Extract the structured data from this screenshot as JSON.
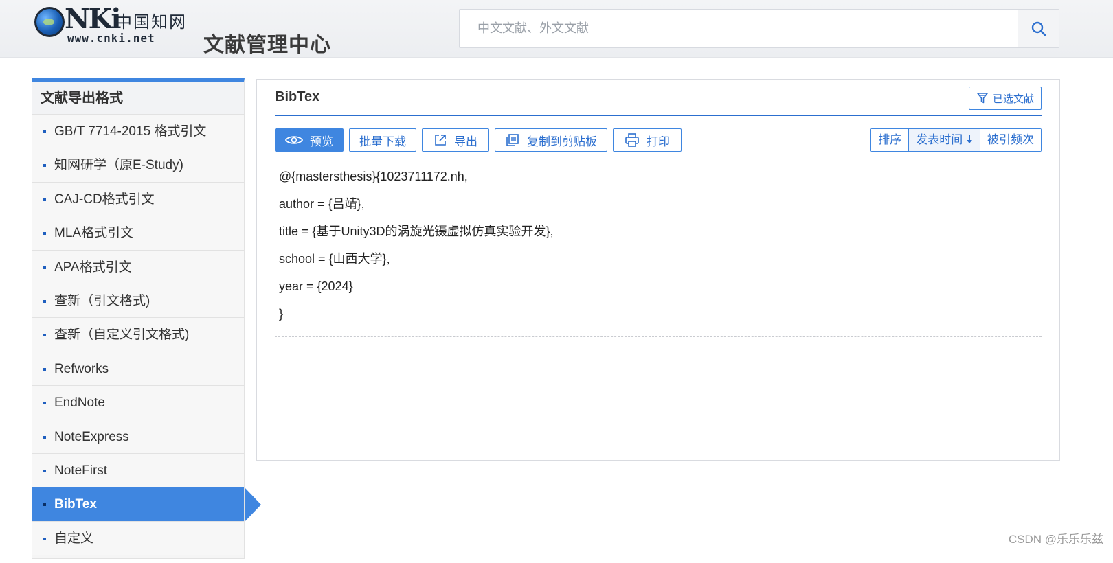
{
  "header": {
    "logo": {
      "brand": "NKi",
      "chinese": "中国知网",
      "url": "www.cnki.net"
    },
    "title": "文献管理中心",
    "search": {
      "placeholder": "中文文献、外文文献",
      "value": ""
    }
  },
  "sidebar": {
    "title": "文献导出格式",
    "items": [
      {
        "label": "GB/T 7714-2015 格式引文"
      },
      {
        "label": "知网研学（原E-Study)"
      },
      {
        "label": "CAJ-CD格式引文"
      },
      {
        "label": "MLA格式引文"
      },
      {
        "label": "APA格式引文"
      },
      {
        "label": "查新（引文格式)"
      },
      {
        "label": "查新（自定义引文格式)"
      },
      {
        "label": "Refworks"
      },
      {
        "label": "EndNote"
      },
      {
        "label": "NoteExpress"
      },
      {
        "label": "NoteFirst"
      },
      {
        "label": "BibTex",
        "active": true
      },
      {
        "label": "自定义"
      }
    ]
  },
  "panel": {
    "title": "BibTex",
    "selected_label": "已选文献",
    "toolbar": {
      "preview": "预览",
      "batch_download": "批量下载",
      "export": "导出",
      "copy": "复制到剪贴板",
      "print": "打印"
    },
    "sort": {
      "label": "排序",
      "by_date": "发表时间",
      "by_citations": "被引频次"
    },
    "bibtex_lines": [
      "@{mastersthesis}{1023711172.nh,",
      "author = {吕靖},",
      "title = {基于Unity3D的涡旋光镊虚拟仿真实验开发},",
      "school = {山西大学},",
      "year = {2024}",
      "}"
    ]
  },
  "watermark": "CSDN @乐乐乐兹",
  "colors": {
    "accent": "#3f86e0",
    "accent_text": "#2c6fcf"
  }
}
